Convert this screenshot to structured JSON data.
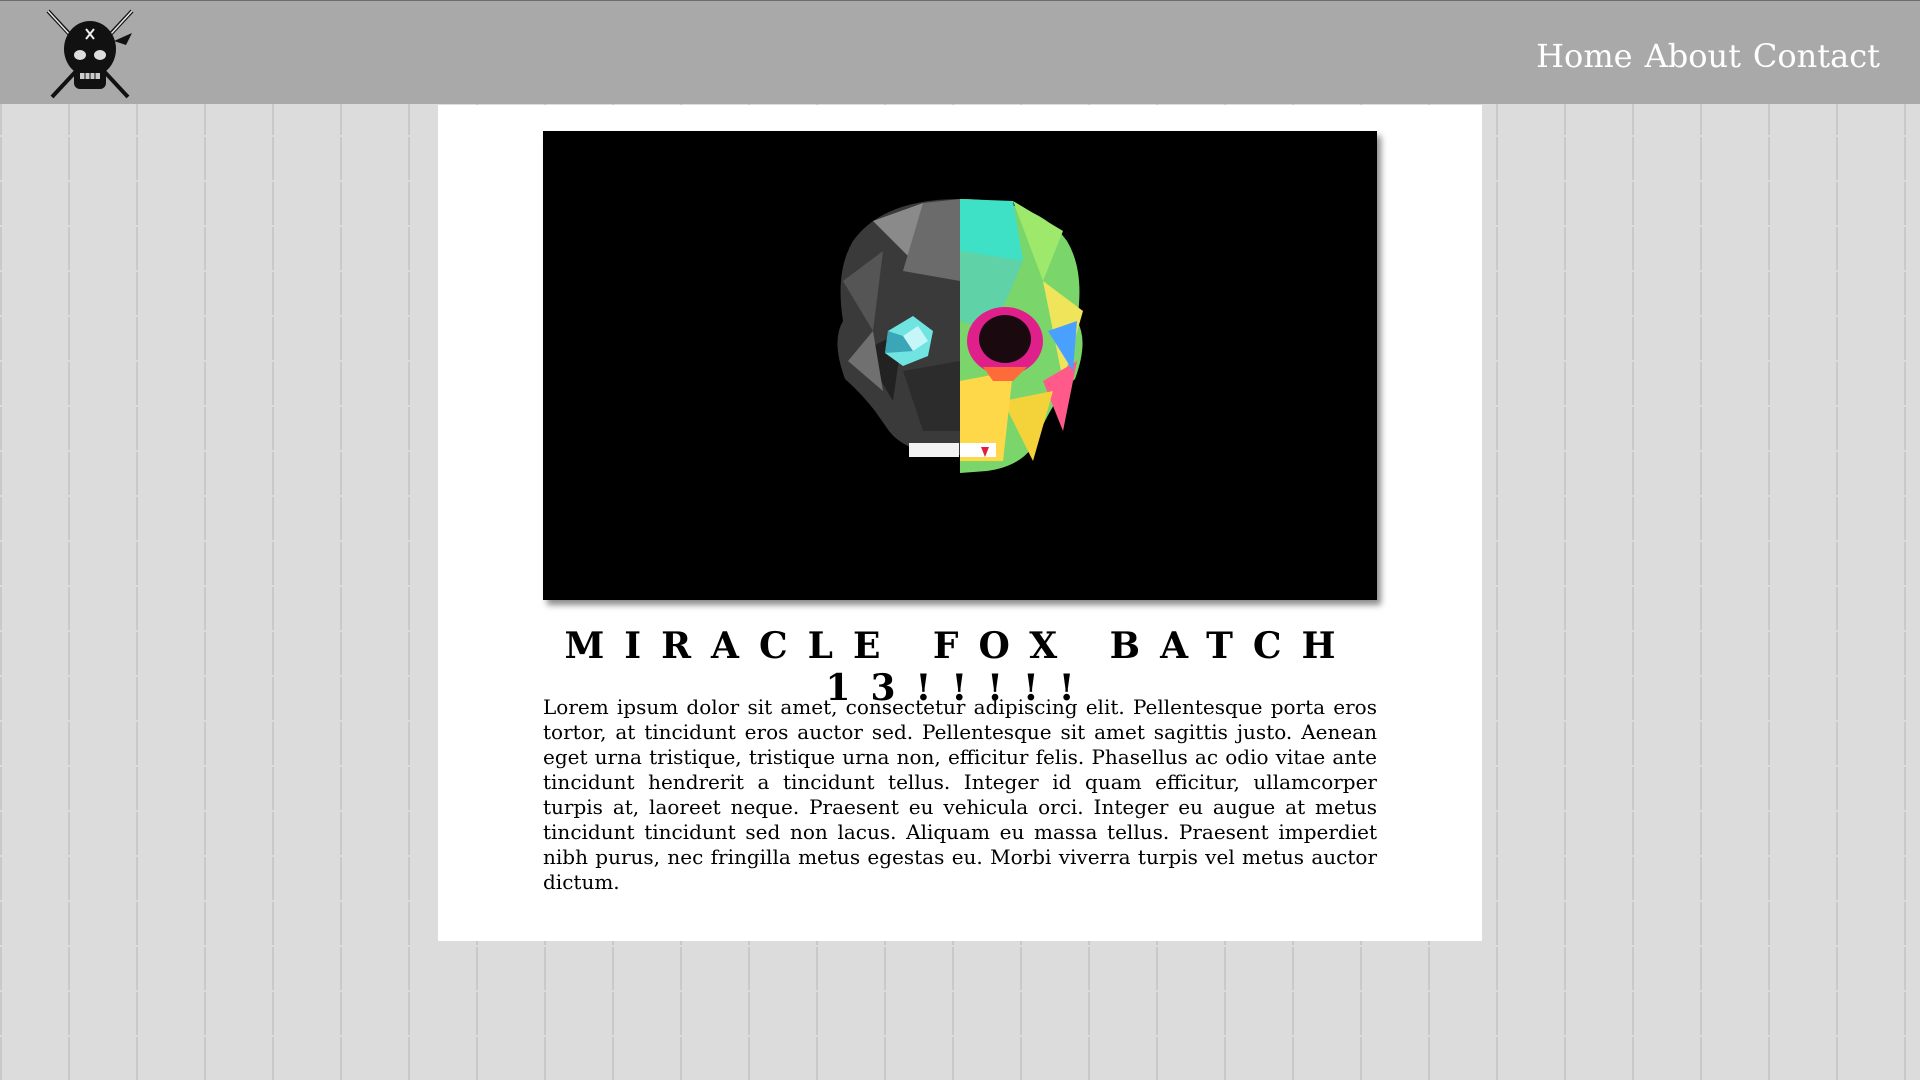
{
  "header": {
    "logo_icon": "ninja-skull-crossed-swords-icon",
    "nav": [
      {
        "label": "Home"
      },
      {
        "label": "About"
      },
      {
        "label": "Contact"
      }
    ]
  },
  "main": {
    "hero_image": "low-poly-half-color-skull-icon",
    "title": "MIRACLE FOX BATCH 13!!!!!",
    "body": "Lorem ipsum dolor sit amet, consectetur adipiscing elit. Pellentesque porta eros tortor, at tincidunt eros auctor sed. Pellentesque sit amet sagittis justo. Aenean eget urna tristique, tristique urna non, efficitur felis. Phasellus ac odio vitae ante tincidunt hendrerit a tincidunt tellus. Integer id quam efficitur, ullamcorper turpis at, laoreet neque. Praesent eu vehicula orci. Integer eu augue at metus tincidunt tincidunt sed non lacus. Aliquam eu massa tellus. Praesent imperdiet nibh purus, nec fringilla metus egestas eu. Morbi viverra turpis vel metus auctor dictum."
  },
  "colors": {
    "navbar": "#a9a9a9",
    "nav_text": "#ffffff",
    "card": "#ffffff",
    "hero_bg": "#000000",
    "wall": "#dcdcdc"
  }
}
